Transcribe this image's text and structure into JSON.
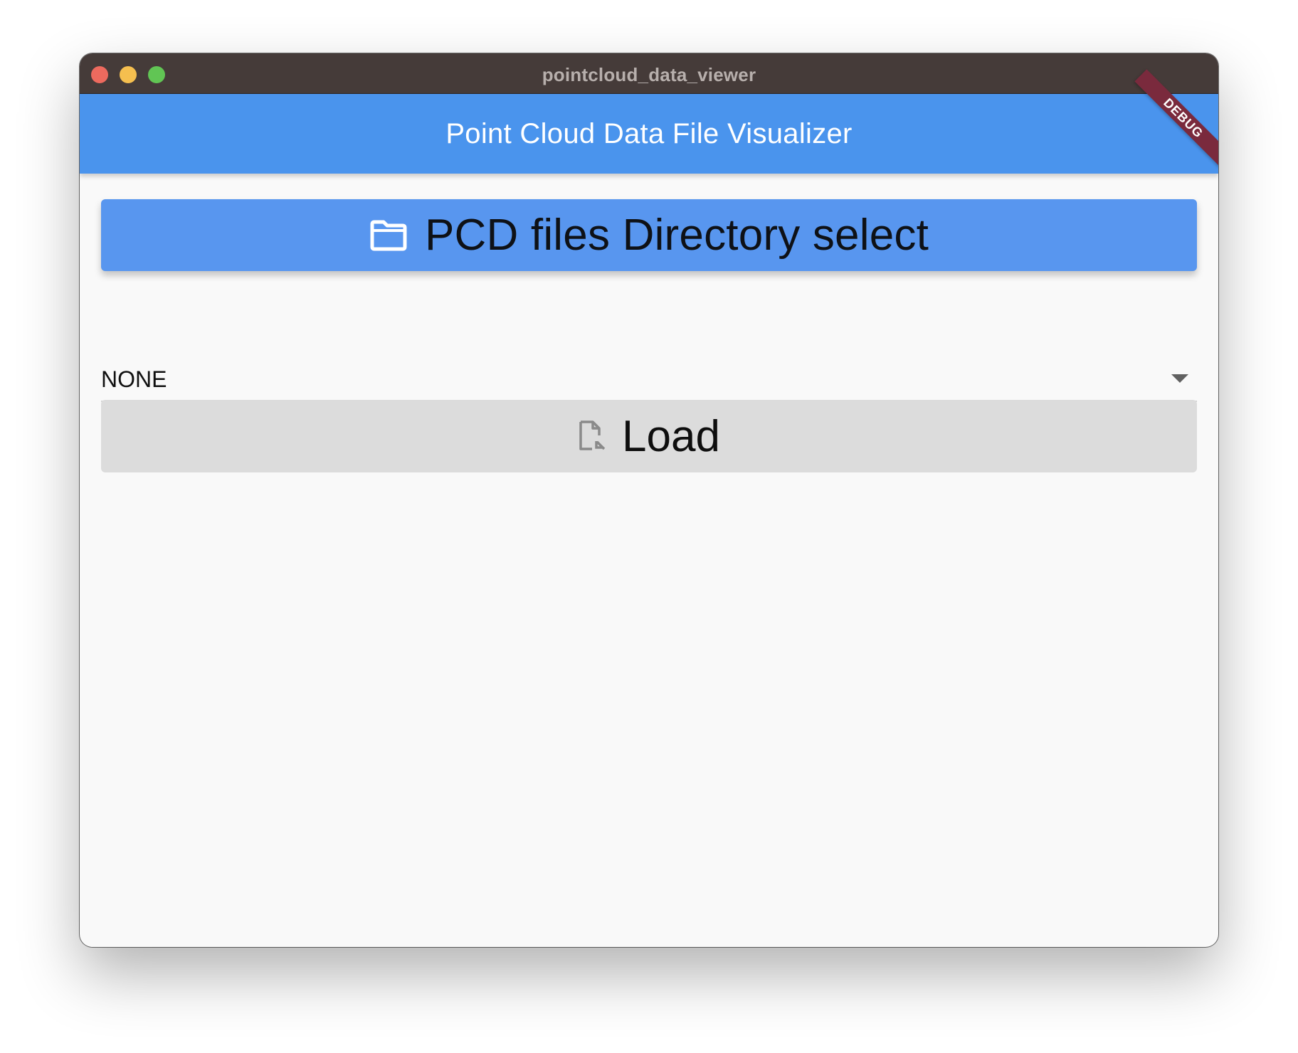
{
  "window": {
    "title": "pointcloud_data_viewer"
  },
  "appbar": {
    "title": "Point Cloud Data File Visualizer",
    "debug_banner": "DEBUG"
  },
  "directory_button": {
    "icon": "folder-icon",
    "label": "PCD files Directory select"
  },
  "file_dropdown": {
    "selected": "NONE",
    "icon": "chevron-down-icon"
  },
  "load_button": {
    "icon": "file-open-icon",
    "label": "Load",
    "enabled": false
  },
  "colors": {
    "titlebar": "#453b39",
    "appbar": "#4a94ed",
    "primary_button": "#5896ef",
    "disabled_button": "#dcdcdc",
    "debug_banner": "#7a2a3d",
    "background": "#f9f9f9"
  }
}
